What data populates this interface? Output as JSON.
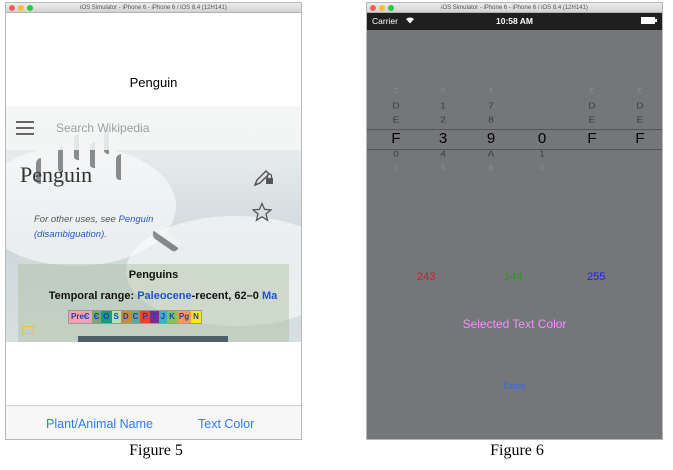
{
  "figure5": {
    "window_title": "iOS Simulator - iPhone 6 - iPhone 6 / iOS 8.4 (12H141)",
    "nav_title": "Penguin",
    "search_placeholder": "Search Wikipedia",
    "page_heading": "Penguin",
    "hatnote_prefix": "For other uses, see ",
    "hatnote_link": "Penguin (disambiguation)",
    "hatnote_suffix": ".",
    "taxobox_title": "Penguins",
    "temporal_label": "Temporal range: ",
    "temporal_link": "Paleocene",
    "temporal_rest": "-recent, 62–0 ",
    "temporal_unit": "Ma",
    "eras": [
      "PreЄ",
      "Є",
      "O",
      "S",
      "D",
      "C",
      "P",
      "T",
      "J",
      "K",
      "Pg",
      "N"
    ],
    "era_colors": [
      "#f4a3b6",
      "#7fa56f",
      "#1a9b7c",
      "#b3e1b6",
      "#cb8c37",
      "#67a599",
      "#f04028",
      "#812b92",
      "#34b2c9",
      "#7fc64e",
      "#fd9a52",
      "#ffe619"
    ],
    "tabs": [
      "Plant/Animal Name",
      "Text Color"
    ],
    "accent_color": "#2b7cf5",
    "caption": "Figure 5"
  },
  "figure6": {
    "window_title": "iOS Simulator - iPhone 6 - iPhone 6 / iOS 8.4 (12H141)",
    "carrier": "Carrier",
    "time": "10:58 AM",
    "picker_columns": [
      [
        "C",
        "D",
        "E",
        "F",
        "0",
        "1"
      ],
      [
        "0",
        "1",
        "2",
        "3",
        "4",
        "5"
      ],
      [
        "6",
        "7",
        "8",
        "9",
        "A",
        "B"
      ],
      [
        "",
        "",
        "",
        "0",
        "1",
        "2"
      ],
      [
        "C",
        "D",
        "E",
        "F",
        "",
        ""
      ],
      [
        "C",
        "D",
        "E",
        "F",
        "",
        ""
      ]
    ],
    "red_value": "243",
    "green_value": "144",
    "blue_value": "255",
    "red_color": "#e0142a",
    "green_color": "#2f9a1c",
    "blue_color": "#1f1ff5",
    "selected_text_label": "Selected Text Color",
    "selected_text_color": "#f390ff",
    "done_label": "Done",
    "caption": "Figure 6"
  }
}
